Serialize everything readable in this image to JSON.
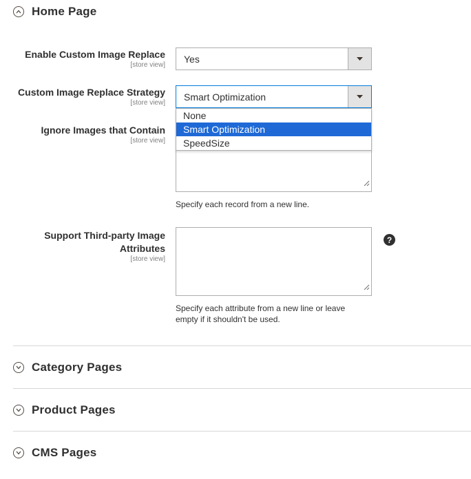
{
  "sections": {
    "home": {
      "title": "Home Page",
      "icon": "collapse-circle-icon"
    },
    "category": {
      "title": "Category Pages",
      "icon": "expand-circle-icon"
    },
    "product": {
      "title": "Product Pages",
      "icon": "expand-circle-icon"
    },
    "cms": {
      "title": "CMS Pages",
      "icon": "expand-circle-icon"
    }
  },
  "fields": {
    "enable_replace": {
      "label": "Enable Custom Image Replace",
      "scope": "[store view]",
      "value": "Yes"
    },
    "replace_strategy": {
      "label": "Custom Image Replace Strategy",
      "scope": "[store view]",
      "value": "Smart Optimization",
      "options": [
        "None",
        "Smart Optimization",
        "SpeedSize"
      ],
      "selected_index": 1
    },
    "ignore_images": {
      "label": "Ignore Images that Contain",
      "scope": "[store view]",
      "value": "",
      "note": "Specify each record from a new line."
    },
    "third_party": {
      "label_line1": "Support Third-party Image",
      "label_line2": "Attributes",
      "scope": "[store view]",
      "value": "",
      "note_line1": "Specify each attribute from a new line or leave",
      "note_line2": "empty if it shouldn't be used.",
      "help": "?"
    }
  },
  "colors": {
    "selected_option_bg": "#1e69d6",
    "focus_border": "#007bdb",
    "text": "#303030",
    "scope_text": "#808080"
  }
}
